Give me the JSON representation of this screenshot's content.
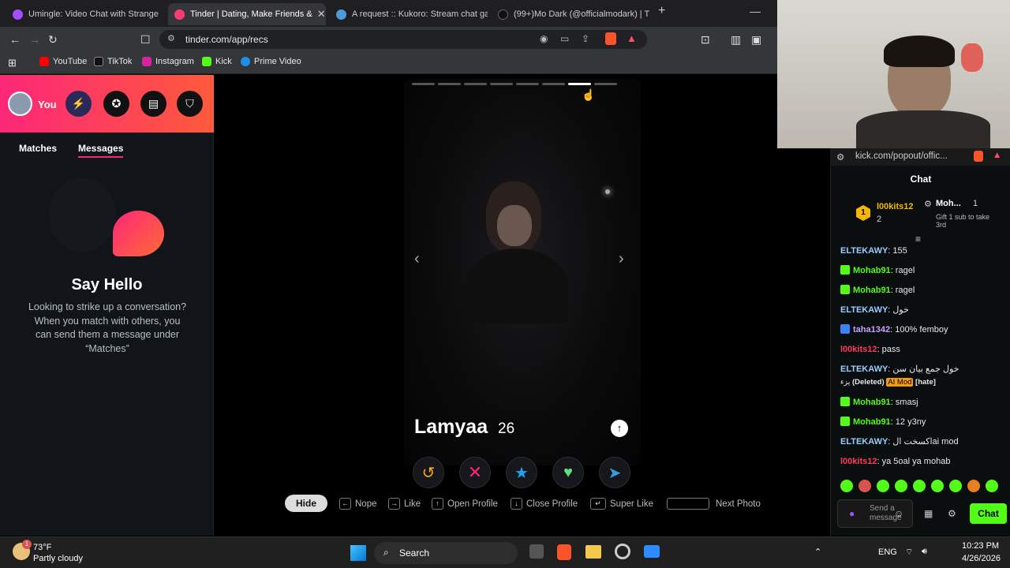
{
  "tabs": [
    {
      "label": "Umingle: Video Chat with Strange",
      "color": "#a64dff"
    },
    {
      "label": "Tinder | Dating, Make Friends &",
      "color": "#fe3c72"
    },
    {
      "label": "A request :: Kukoro: Stream chat gam",
      "color": "#4a9bd9"
    },
    {
      "label": "(99+)Mo Dark (@officialmodark) | Ti",
      "color": "#111"
    }
  ],
  "address": {
    "url": "tinder.com/app/recs"
  },
  "bookmarks": [
    {
      "label": "YouTube",
      "color": "#ff0000"
    },
    {
      "label": "TikTok",
      "color": "#111"
    },
    {
      "label": "Instagram",
      "color": "#d6249f"
    },
    {
      "label": "Kick",
      "color": "#53fc18"
    },
    {
      "label": "Prime Video",
      "color": "#1f8ee6"
    }
  ],
  "sidebar": {
    "you_label": "You",
    "tabs": [
      "Matches",
      "Messages"
    ],
    "title": "Say Hello",
    "description": "Looking to strike up a conversation? When you match with others, you can send them a message under “Matches”"
  },
  "profile": {
    "name": "Lamyaa",
    "age": "26",
    "photo_count": 8,
    "current_photo": 7
  },
  "hints": {
    "hide": "Hide",
    "nope": "Nope",
    "like": "Like",
    "open": "Open Profile",
    "close": "Close Profile",
    "super": "Super Like",
    "next": "Next Photo"
  },
  "kick": {
    "url": "kick.com/popout/offic...",
    "title": "Chat",
    "leader1": {
      "name": "l00kits12",
      "count": "2"
    },
    "leader2": {
      "name": "Moh...",
      "count": "1",
      "sub": "Gift 1 sub to take 3rd"
    },
    "messages": [
      {
        "user": "ELTEKAWY",
        "text": "155",
        "color": "#9cf",
        "badge": ""
      },
      {
        "user": "Mohab91",
        "text": "ragel",
        "color": "#53fc18",
        "badge": "#53fc18"
      },
      {
        "user": "Mohab91",
        "text": "ragel",
        "color": "#53fc18",
        "badge": "#53fc18"
      },
      {
        "user": "ELTEKAWY",
        "text": "خول",
        "color": "#9cf",
        "badge": ""
      },
      {
        "user": "taha1342",
        "text": "100% femboy",
        "color": "#c9a0ff",
        "badge": "#3b82f6"
      },
      {
        "user": "l00kits12",
        "text": "pass",
        "color": "#ff3b5c",
        "badge": ""
      },
      {
        "user": "ELTEKAWY",
        "text": "خول جمع بيان سن",
        "color": "#9cf",
        "badge": ""
      },
      {
        "user": "Mohab91",
        "text": "smasj",
        "color": "#53fc18",
        "badge": "#53fc18"
      },
      {
        "user": "Mohab91",
        "text": "12 y3ny",
        "color": "#53fc18",
        "badge": "#53fc18"
      },
      {
        "user": "ELTEKAWY",
        "text": "اكسخت الai mod",
        "color": "#9cf",
        "badge": ""
      },
      {
        "user": "l00kits12",
        "text": "ya 5oal ya mohab",
        "color": "#ff3b5c",
        "badge": ""
      }
    ],
    "deleted_line": {
      "prefix": "يزء",
      "deleted": "(Deleted)",
      "mod": "AI Mod",
      "tag": "[hate]"
    },
    "input_placeholder": "Send a message",
    "send_label": "Chat"
  },
  "taskbar": {
    "temp": "73°F",
    "weather": "Partly cloudy",
    "search": "Search",
    "lang": "ENG",
    "time": "10:23 PM",
    "date": "4/26/2026",
    "notif": "1"
  }
}
